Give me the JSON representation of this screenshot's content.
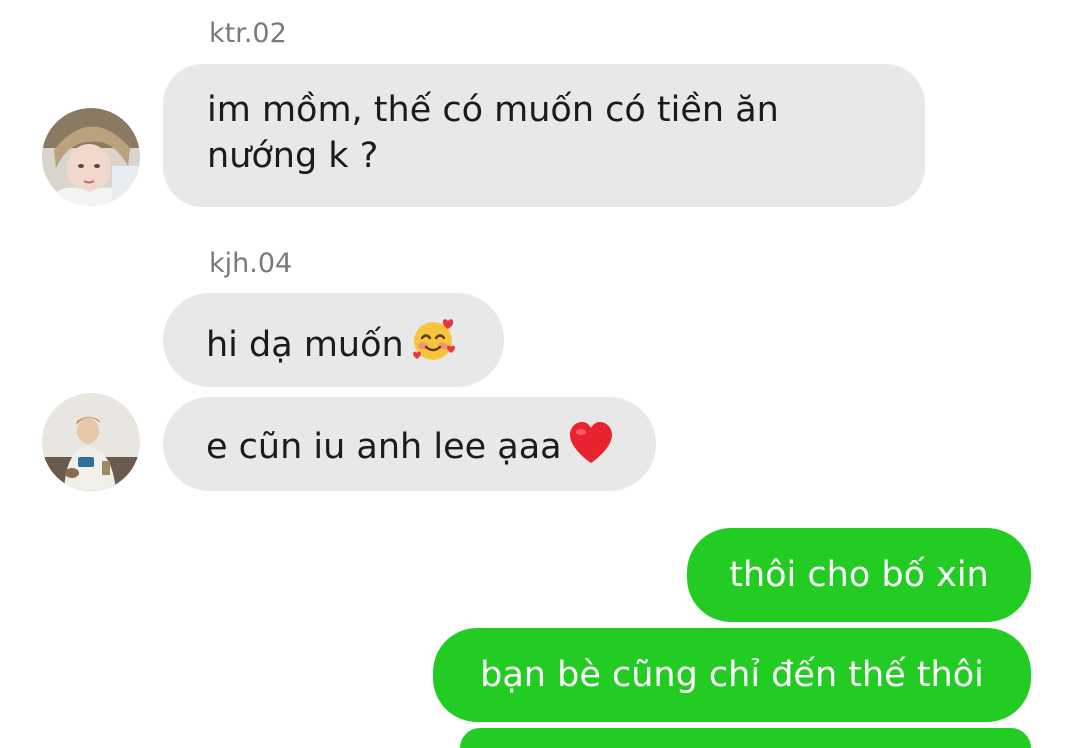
{
  "conversation": {
    "groups": [
      {
        "sender": "ktr.02",
        "avatar": "user-avatar-photo",
        "messages": [
          {
            "line1": "im mồm, thế có muốn có tiền ăn",
            "line2": "nướng k ?"
          }
        ]
      },
      {
        "sender": "kjh.04",
        "avatar": "user-avatar-photo",
        "messages": [
          {
            "text": "hi dạ muốn",
            "emoji": "smiling-face-with-hearts-emoji"
          },
          {
            "text": "e cũn iu anh lee ạaa",
            "emoji": "red-heart-emoji"
          }
        ]
      }
    ],
    "outgoing": [
      {
        "text": "thôi cho bố xin"
      },
      {
        "text": "bạn bè cũng chỉ đến thế thôi"
      }
    ]
  },
  "colors": {
    "incoming_bubble": "#e8e8e8",
    "outgoing_bubble": "#22cc22",
    "sender_name": "#7a7a7a"
  }
}
